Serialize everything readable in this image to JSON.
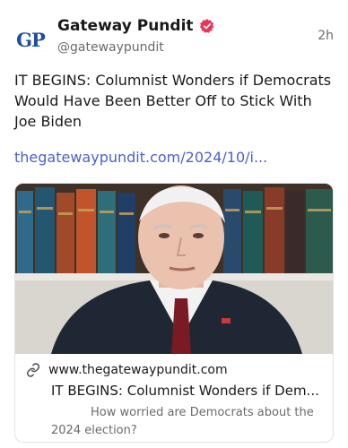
{
  "author": {
    "avatar_text": "GP",
    "name": "Gateway Pundit",
    "handle": "@gatewaypundit",
    "verified_icon": "verified-badge-icon",
    "verified_color": "#e8375a"
  },
  "post": {
    "time": "2h",
    "text": "IT BEGINS: Columnist Wonders if Democrats Would Have Been Better Off to Stick With Joe Biden",
    "link_text": "thegatewaypundit.com/2024/10/i..."
  },
  "link_card": {
    "link_icon": "link-icon",
    "domain": "www.thegatewaypundit.com",
    "title": "IT BEGINS: Columnist Wonders if Dem...",
    "description": "How worried are Democrats about the 2024 election?"
  },
  "colors": {
    "link": "#4a5fd0",
    "secondary_text": "#6b6b6b",
    "brand_blue": "#1d4f9c"
  }
}
